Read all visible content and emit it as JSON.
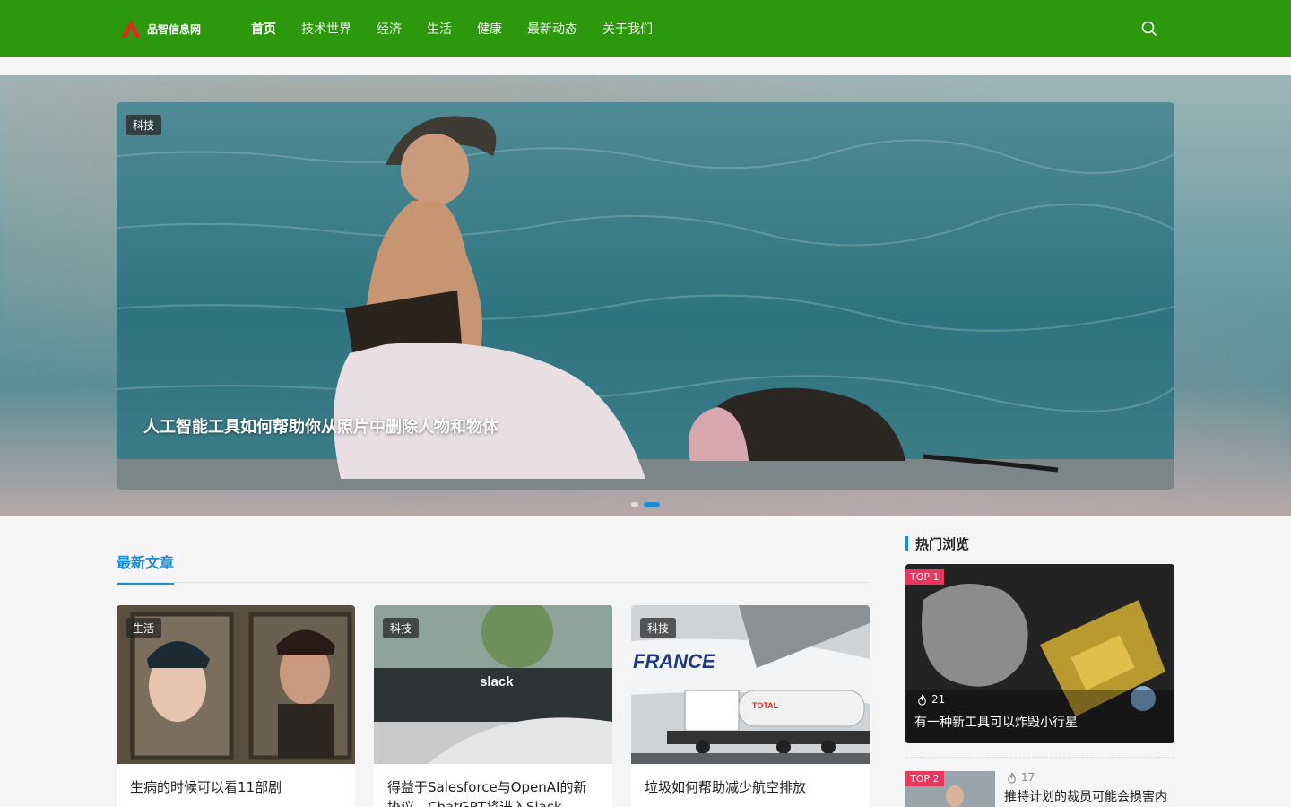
{
  "header": {
    "logo_text": "品智信息网",
    "nav": [
      "首页",
      "技术世界",
      "经济",
      "生活",
      "健康",
      "最新动态",
      "关于我们"
    ],
    "active_index": 0,
    "brand_color": "#2b980d"
  },
  "hero": {
    "category": "科技",
    "title": "人工智能工具如何帮助你从照片中删除人物和物体",
    "slide_count": 2,
    "active_slide": 1
  },
  "latest": {
    "title": "最新文章",
    "accent_color": "#1a8cd8",
    "cards": [
      {
        "category": "生活",
        "title": "生病的时候可以看11部剧"
      },
      {
        "category": "科技",
        "title": "得益于Salesforce与OpenAI的新协议，ChatGPT将进入Slack"
      },
      {
        "category": "科技",
        "title": "垃圾如何帮助减少航空排放"
      }
    ]
  },
  "sidebar": {
    "title": "热门浏览",
    "items": [
      {
        "rank": "TOP 1",
        "views": "21",
        "title": "有一种新工具可以炸毁小行星"
      },
      {
        "rank": "TOP 2",
        "views": "17",
        "title": "推特计划的裁员可能会损害内"
      }
    ]
  }
}
